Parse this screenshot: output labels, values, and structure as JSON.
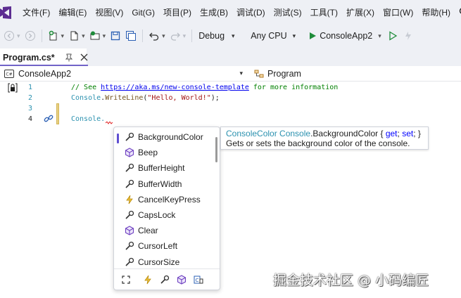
{
  "app": {
    "logo": "visual-studio-logo"
  },
  "menu": {
    "items": [
      "文件(F)",
      "编辑(E)",
      "视图(V)",
      "Git(G)",
      "项目(P)",
      "生成(B)",
      "调试(D)",
      "测试(S)",
      "工具(T)",
      "扩展(X)",
      "窗口(W)",
      "帮助(H)"
    ],
    "search_label": "搜"
  },
  "toolbar": {
    "configuration": "Debug",
    "platform": "Any CPU",
    "startup_project": "ConsoleApp2"
  },
  "tabs": [
    {
      "label": "Program.cs*"
    }
  ],
  "navbar": {
    "project": "ConsoleApp2",
    "member": "Program"
  },
  "editor": {
    "lines": [
      {
        "num": "1",
        "comment_prefix": "// See ",
        "link": "https://aka.ms/new-console-template",
        "comment_suffix": " for more information"
      },
      {
        "num": "2",
        "type": "Console",
        "dot": ".",
        "method": "WriteLine",
        "open": "(",
        "string": "\"Hello, World!\"",
        "close": ");"
      },
      {
        "num": "3"
      },
      {
        "num": "4",
        "text": "Console."
      }
    ]
  },
  "completion": {
    "items": [
      {
        "label": "BackgroundColor",
        "icon": "wrench-icon",
        "selected": true
      },
      {
        "label": "Beep",
        "icon": "cube-icon"
      },
      {
        "label": "BufferHeight",
        "icon": "wrench-icon"
      },
      {
        "label": "BufferWidth",
        "icon": "wrench-icon"
      },
      {
        "label": "CancelKeyPress",
        "icon": "lightning-icon"
      },
      {
        "label": "CapsLock",
        "icon": "wrench-icon"
      },
      {
        "label": "Clear",
        "icon": "cube-icon"
      },
      {
        "label": "CursorLeft",
        "icon": "wrench-icon"
      },
      {
        "label": "CursorSize",
        "icon": "wrench-icon"
      }
    ],
    "filters": [
      "expand-icon",
      "lightning-icon",
      "wrench-icon",
      "cube-icon",
      "namespace-icon"
    ]
  },
  "tooltip": {
    "type": "ConsoleColor",
    "owner": "Console",
    "member": ".BackgroundColor",
    "open_brace": " { ",
    "kw_get": "get",
    "sep1": "; ",
    "kw_set": "set",
    "sep2": "; }",
    "description": "Gets or sets the background color of the console."
  },
  "watermark": "掘金技术社区 @ 小码编匠",
  "colors": {
    "accent": "#7163c8",
    "selection": "#5f4fd1",
    "run_green": "#1e8c3a"
  }
}
